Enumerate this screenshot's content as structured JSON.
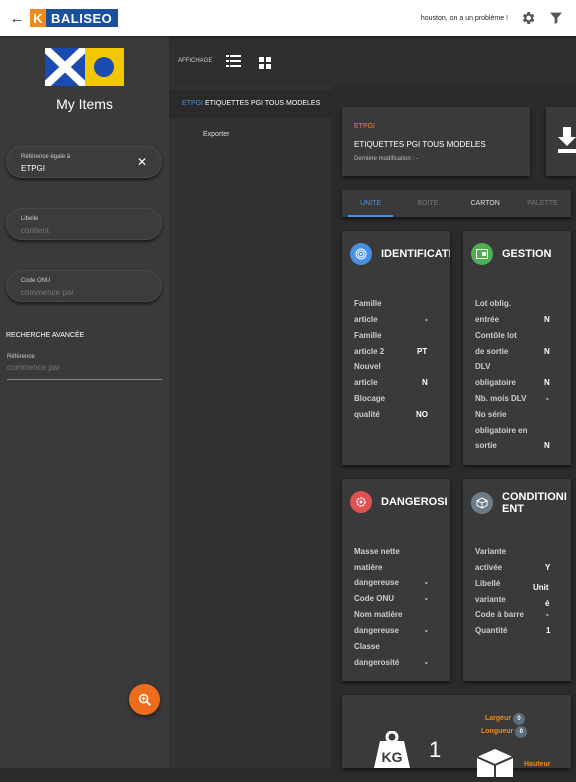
{
  "topbar": {
    "back_icon": "arrow-left-icon",
    "logo_text": "BALISEO",
    "logo_mark": "K",
    "message": "houston, on a un problème !",
    "settings_icon": "gear-icon",
    "filter_icon": "filter-icon"
  },
  "left": {
    "title": "My Items",
    "filter1": {
      "label": "Référence égale à",
      "value": "ETPGI",
      "clear_icon": "close-icon"
    },
    "filter2": {
      "label": "Libellé",
      "placeholder": "contient"
    },
    "filter3": {
      "label": "Code ONU",
      "placeholder": "commence par"
    },
    "advanced_label": "RECHERCHE AVANCÉE",
    "reference": {
      "label": "Référence",
      "placeholder": "commence par"
    },
    "fab_icon": "search-zoom-icon"
  },
  "toolbar": {
    "affichage_label": "AFFICHAGE",
    "list_icon": "list-view-icon",
    "grid_icon": "grid-view-icon"
  },
  "nav": {
    "code": "ETPGI",
    "title": "ETIQUETTES PGI TOUS MODELES",
    "export_label": "Exporter"
  },
  "header_card": {
    "code": "ETPGI",
    "title": "ETIQUETTES PGI TOUS MODELES",
    "modified": "Dernière modification : -",
    "download_icon": "download-icon"
  },
  "tabs": [
    "UNITE",
    "BOITE",
    "CARTON",
    "PALETTE"
  ],
  "identification": {
    "title": "IDENTIFICATI",
    "rows": [
      {
        "label": [
          "Famille",
          "article"
        ],
        "value": "-"
      },
      {
        "label": [
          "Famille",
          "article 2"
        ],
        "value": "PT"
      },
      {
        "label": [
          "Nouvel",
          "article"
        ],
        "value": "N"
      },
      {
        "label": [
          "Blocage",
          "qualité"
        ],
        "value": "NO"
      }
    ]
  },
  "gestion": {
    "title": "GESTION",
    "rows": [
      {
        "label": [
          "Lot oblig.",
          "entrée"
        ],
        "value": "N"
      },
      {
        "label": [
          "Contôle lot",
          "de sortie"
        ],
        "value": "N"
      },
      {
        "label": [
          "DLV",
          "obligatoire"
        ],
        "value": "N"
      },
      {
        "label": [
          "Nb. mois DLV"
        ],
        "value": "-"
      },
      {
        "label": [
          "No série",
          "obligatoire en",
          "sortie"
        ],
        "value": "N"
      }
    ]
  },
  "dangerosite": {
    "title": "DANGEROSI",
    "rows": [
      {
        "label": [
          "Masse nette",
          "matière",
          "dangereuse"
        ],
        "value": "-"
      },
      {
        "label": [
          "Code ONU"
        ],
        "value": "-"
      },
      {
        "label": [
          "Nom matière",
          "dangereuse"
        ],
        "value": "-"
      },
      {
        "label": [
          "Classe",
          "dangerosité"
        ],
        "value": "-"
      }
    ]
  },
  "conditionnement": {
    "title_l1": "CONDITIONI",
    "title_l2": "ENT",
    "rows": [
      {
        "label": [
          "Variante",
          "activée"
        ],
        "value": "Y"
      },
      {
        "label": [
          "Libellé",
          "variante"
        ],
        "value": [
          "Unit",
          "é"
        ]
      },
      {
        "label": [
          "Code à barre"
        ],
        "value": "-"
      },
      {
        "label": [
          "Quantité"
        ],
        "value": "1"
      }
    ]
  },
  "dims": {
    "weight_icon": "weight-kg-icon",
    "weight_value": "1",
    "largeur_label": "Largeur",
    "largeur_value": "0",
    "longueur_label": "Longueur",
    "longueur_value": "0",
    "hauteur_label": "Hauteur",
    "box_icon": "box-icon"
  },
  "colors": {
    "accent": "#4a90e2",
    "orange": "#f08a1c",
    "ident_icon": "#4a90e2",
    "gestion_icon": "#4caf50",
    "danger_icon": "#e05252",
    "cond_icon": "#6b7c88"
  }
}
